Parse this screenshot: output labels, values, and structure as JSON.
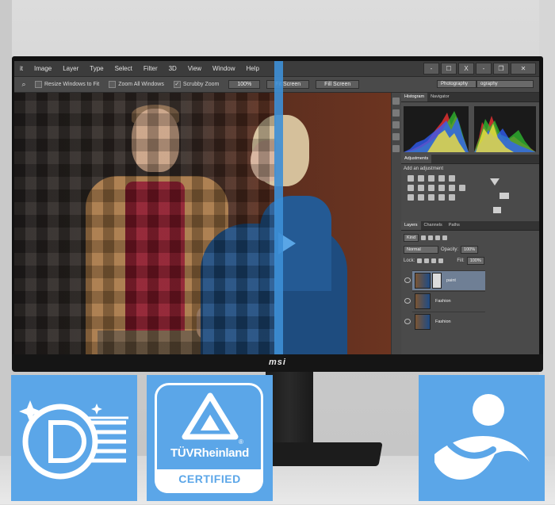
{
  "menubar": {
    "items": [
      "it",
      "Image",
      "Layer",
      "Type",
      "Select",
      "Filter",
      "3D",
      "View",
      "Window",
      "Help"
    ],
    "window_buttons": [
      "-",
      "☐",
      "X",
      "-",
      "❐",
      "✕"
    ]
  },
  "options_bar": {
    "resize_windows_label": "Resize Windows to Fit",
    "zoom_all_label": "Zoom All Windows",
    "scrubby_zoom_label": "Scrubby Zoom",
    "zoom_value": "100%",
    "fit_screen_label": "Fit Screen",
    "fill_screen_label": "Fill Screen",
    "workspace_1": "Photography",
    "workspace_2": "ography"
  },
  "panels": {
    "histogram_tab": "Histogram",
    "navigator_tab": "Navigator",
    "adjustments_tab": "Adjustments",
    "add_adjustment_label": "Add an adjustment",
    "layers_tab": "Layers",
    "channels_tab": "Channels",
    "paths_tab": "Paths",
    "kind_label": "Kind",
    "blend_mode": "Normal",
    "opacity_label": "Opacity:",
    "opacity_value": "100%",
    "lock_label": "Lock:",
    "fill_label": "Fill:",
    "fill_value": "100%",
    "layers": [
      {
        "name": "paint",
        "selected": true
      },
      {
        "name": "Fashion",
        "selected": false
      },
      {
        "name": "Fashion",
        "selected": false
      }
    ]
  },
  "monitor": {
    "brand": "msi"
  },
  "badges": {
    "tuv_name": "TÜVRheinland",
    "tuv_reg": "®",
    "tuv_certified": "CERTIFIED"
  },
  "colors": {
    "accent_blue": "#5ba6e8",
    "split_line": "#3d8fd6"
  }
}
